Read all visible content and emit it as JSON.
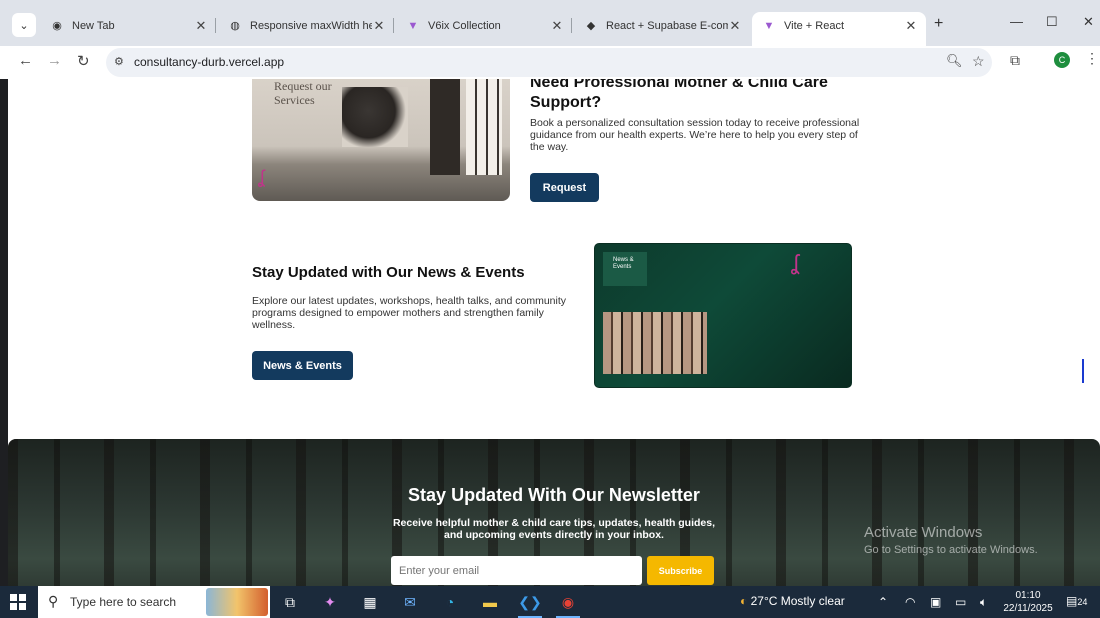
{
  "browser": {
    "tabs": [
      {
        "label": "New Tab",
        "icon": "chrome-icon"
      },
      {
        "label": "Responsive maxWidth heigh",
        "icon": "globe-icon"
      },
      {
        "label": "V6ix Collection",
        "icon": "vite-icon"
      },
      {
        "label": "React + Supabase E-comme",
        "icon": "diamond-icon"
      },
      {
        "label": "Vite + React",
        "icon": "vite-icon",
        "active": true
      }
    ],
    "url": "consultancy-durb.vercel.app",
    "profile_initial": "C"
  },
  "page": {
    "services_image_text": "Request our Services",
    "request": {
      "title": "Need Professional Mother & Child Care Support?",
      "description": "Book a personalized consultation session today to receive professional guidance from our health experts. We’re here to help you every step of the way.",
      "button": "Request"
    },
    "news": {
      "title": "Stay Updated with Our News & Events",
      "description": "Explore our latest updates, workshops, health talks, and community programs designed to empower mothers and strengthen family wellness.",
      "button": "News & Events",
      "image_card_text": "News & Events"
    },
    "newsletter": {
      "title": "Stay Updated With Our Newsletter",
      "description": "Receive helpful mother & child care tips, updates, health guides, and upcoming events directly in your inbox.",
      "input_placeholder": "Enter your email",
      "button": "Subscribe"
    },
    "watermark": {
      "line1": "Activate Windows",
      "line2": "Go to Settings to activate Windows."
    }
  },
  "taskbar": {
    "search_placeholder": "Type here to search",
    "weather": "27°C  Mostly clear",
    "time": "01:10",
    "date": "22/11/2025",
    "notifications": "24"
  }
}
